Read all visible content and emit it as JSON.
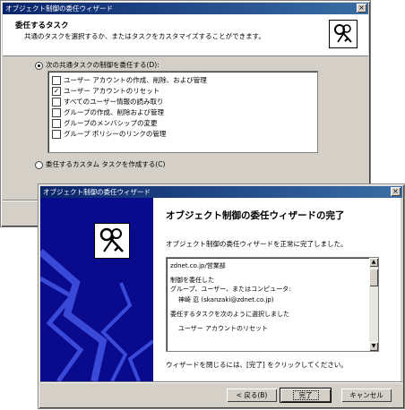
{
  "back_window": {
    "title": "オブジェクト制御の委任ウィザード",
    "header_title": "委任するタスク",
    "header_desc": "共通のタスクを選択するか、またはタスクをカスタマイズすることができます。",
    "radio_common": "次の共通タスクの制御を委任する(D):",
    "tasks": [
      {
        "label": "ユーザー アカウントの作成、削除、および管理",
        "checked": false
      },
      {
        "label": "ユーザー アカウントのリセット",
        "checked": true
      },
      {
        "label": "すべてのユーザー情報の読み取り",
        "checked": false
      },
      {
        "label": "グループの作成、削除および管理",
        "checked": false
      },
      {
        "label": "グループのメンバシップの変更",
        "checked": false
      },
      {
        "label": "グループ ポリシーのリンクの管理",
        "checked": false
      }
    ],
    "radio_custom": "委任するカスタム タスクを作成する(C)"
  },
  "front_window": {
    "title": "オブジェクト制御の委任ウィザード",
    "heading": "オブジェクト制御の委任ウィザードの完了",
    "intro": "オブジェクト制御の委任ウィザードを正常に完了しました。",
    "summary_lines": [
      "zdnet.co.jp/営業部",
      "",
      "制御を委任した",
      "グループ、ユーザー、またはコンピュータ:",
      "    神崎 忍 (skanzaki@zdnet.co.jp)",
      "",
      "委任するタスクを次のように選択しました",
      "",
      "    ユーザー アカウントのリセット"
    ],
    "footer_text": "ウィザードを閉じるには、[完了] をクリックしてください。",
    "buttons": {
      "back": "< 戻る(B)",
      "finish": "完了",
      "cancel": "キャンセル"
    }
  }
}
